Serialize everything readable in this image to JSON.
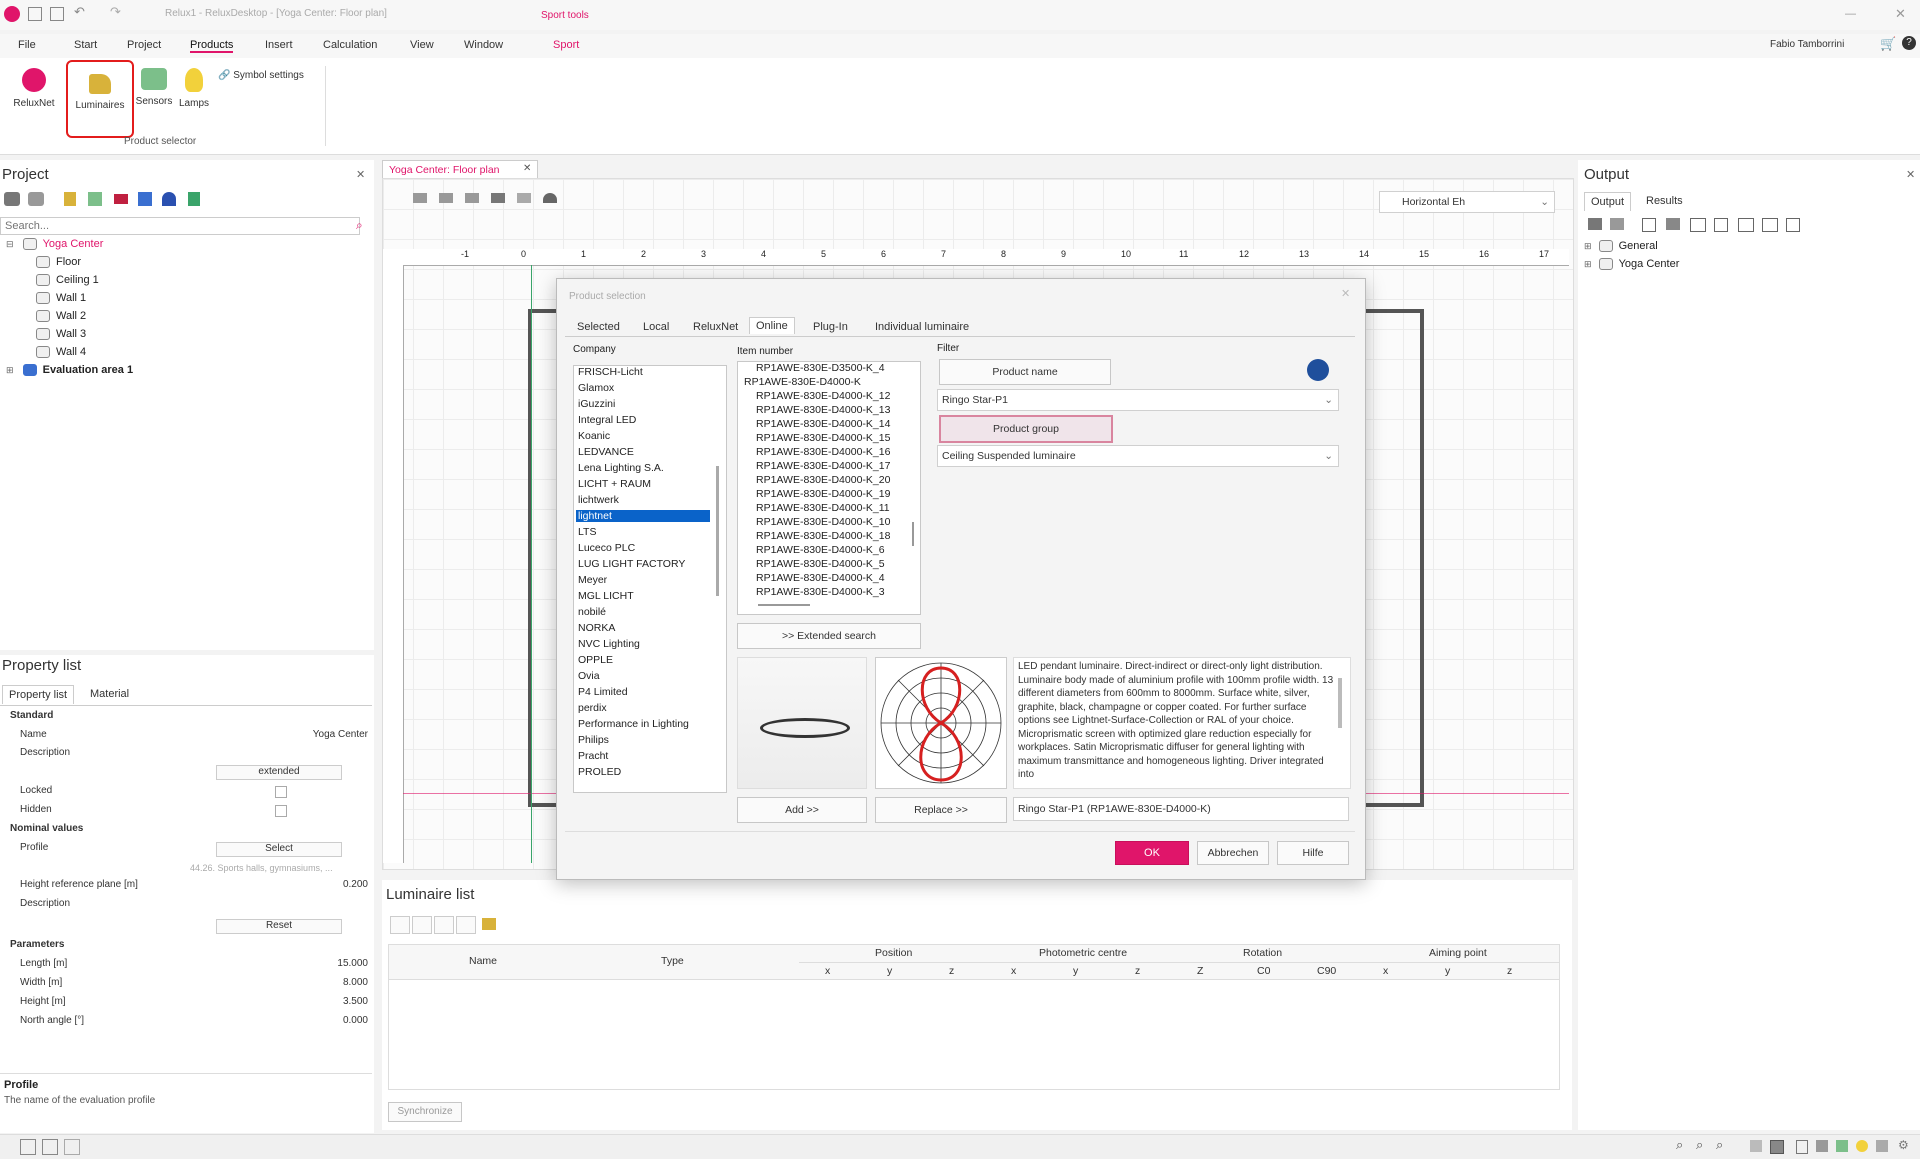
{
  "window": {
    "title": "Relux1 - ReluxDesktop - [Yoga Center: Floor plan]",
    "context_tab": "Sport tools",
    "user": "Fabio Tamborrini",
    "accent": "#e0156a"
  },
  "menu": [
    "File",
    "Start",
    "Project",
    "Products",
    "Insert",
    "Calculation",
    "View",
    "Window",
    "Sport"
  ],
  "ribbon": {
    "buttons": [
      "ReluxNet",
      "Luminaires",
      "Sensors",
      "Lamps"
    ],
    "symbol_settings": "Symbol settings",
    "group_label": "Product selector"
  },
  "project": {
    "title": "Project",
    "search_placeholder": "Search...",
    "tree": [
      "Yoga Center",
      "Floor",
      "Ceiling 1",
      "Wall 1",
      "Wall 2",
      "Wall 3",
      "Wall 4",
      "Evaluation area 1"
    ]
  },
  "property_list": {
    "title": "Property list",
    "tabs": [
      "Property list",
      "Material"
    ],
    "sections": {
      "standard": "Standard",
      "nominal": "Nominal values",
      "parameters": "Parameters"
    },
    "rows": {
      "name_label": "Name",
      "name_value": "Yoga Center",
      "description_label": "Description",
      "extended_btn": "extended",
      "locked_label": "Locked",
      "hidden_label": "Hidden",
      "profile_label": "Profile",
      "select_btn": "Select",
      "profile_hint": "44.26. Sports halls, gymnasiums, ...",
      "height_ref_label": "Height reference plane [m]",
      "height_ref_value": "0.200",
      "description2_label": "Description",
      "reset_btn": "Reset",
      "length_label": "Length [m]",
      "length_value": "15.000",
      "width_label": "Width [m]",
      "width_value": "8.000",
      "height_label": "Height [m]",
      "height_value": "3.500",
      "north_label": "North angle [°]",
      "north_value": "0.000"
    },
    "footer_title": "Profile",
    "footer_desc": "The name of the evaluation profile"
  },
  "document_tab": "Yoga Center: Floor plan",
  "view_combo": "Horizontal Eh",
  "ruler_labels": [
    "-1",
    "0",
    "1",
    "2",
    "3",
    "4",
    "5",
    "6",
    "7",
    "8",
    "9",
    "10",
    "11",
    "12",
    "13",
    "14",
    "15",
    "16",
    "17"
  ],
  "dialog": {
    "title": "Product selection",
    "tabs": [
      "Selected",
      "Local",
      "ReluxNet",
      "Online",
      "Plug-In",
      "Individual luminaire"
    ],
    "active_tab": "Online",
    "company_label": "Company",
    "companies": [
      "FRISCH-Licht",
      "Glamox",
      "iGuzzini",
      "Integral LED",
      "Koanic",
      "LEDVANCE",
      "Lena Lighting S.A.",
      "LICHT + RAUM",
      "lichtwerk",
      "lightnet",
      "LTS",
      "Luceco PLC",
      "LUG LIGHT FACTORY",
      "Meyer",
      "MGL LICHT",
      "nobilé",
      "NORKA",
      "NVC Lighting",
      "OPPLE",
      "Ovia",
      "P4 Limited",
      "perdix",
      "Performance in Lighting",
      "Philips",
      "Pracht",
      "PROLED"
    ],
    "selected_company": "lightnet",
    "item_number_label": "Item number",
    "items": [
      "RP1AWE-830E-D3500-K_4",
      "RP1AWE-830E-D4000-K",
      "RP1AWE-830E-D4000-K_12",
      "RP1AWE-830E-D4000-K_13",
      "RP1AWE-830E-D4000-K_14",
      "RP1AWE-830E-D4000-K_15",
      "RP1AWE-830E-D4000-K_16",
      "RP1AWE-830E-D4000-K_17",
      "RP1AWE-830E-D4000-K_20",
      "RP1AWE-830E-D4000-K_19",
      "RP1AWE-830E-D4000-K_11",
      "RP1AWE-830E-D4000-K_10",
      "RP1AWE-830E-D4000-K_18",
      "RP1AWE-830E-D4000-K_6",
      "RP1AWE-830E-D4000-K_5",
      "RP1AWE-830E-D4000-K_4",
      "RP1AWE-830E-D4000-K_3"
    ],
    "filter_label": "Filter",
    "product_name_btn": "Product name",
    "product_name_value": "Ringo Star-P1",
    "product_group_btn": "Product group",
    "product_group_value": "Ceiling Suspended luminaire",
    "extended_search": ">> Extended search",
    "description": "LED pendant luminaire. Direct-indirect or direct-only light distribution. Luminaire body made of aluminium profile with 100mm profile width. 13 different diameters from 600mm to 8000mm. Surface white, silver, graphite, black, champagne or copper coated. For further surface options see Lightnet-Surface-Collection or RAL of your choice. Microprismatic screen with optimized glare reduction especially for workplaces. Satin Microprismatic diffuser for general lighting with maximum transmittance and homogeneous lighting. Driver integrated into",
    "add_btn": "Add >>",
    "replace_btn": "Replace >>",
    "selected_product": "Ringo Star-P1 (RP1AWE-830E-D4000-K)",
    "ok_btn": "OK",
    "cancel_btn": "Abbrechen",
    "help_btn": "Hilfe"
  },
  "output": {
    "title": "Output",
    "tabs": [
      "Output",
      "Results"
    ],
    "tree": [
      "General",
      "Yoga Center"
    ]
  },
  "luminaire_list": {
    "title": "Luminaire list",
    "headers": {
      "name": "Name",
      "type": "Type",
      "position": "Position",
      "photometric": "Photometric centre",
      "rotation": "Rotation",
      "aiming": "Aiming point"
    },
    "sub_headers": [
      "x",
      "y",
      "z",
      "x",
      "y",
      "z",
      "Z",
      "C0",
      "C90",
      "x",
      "y",
      "z"
    ],
    "sync_btn": "Synchronize"
  }
}
